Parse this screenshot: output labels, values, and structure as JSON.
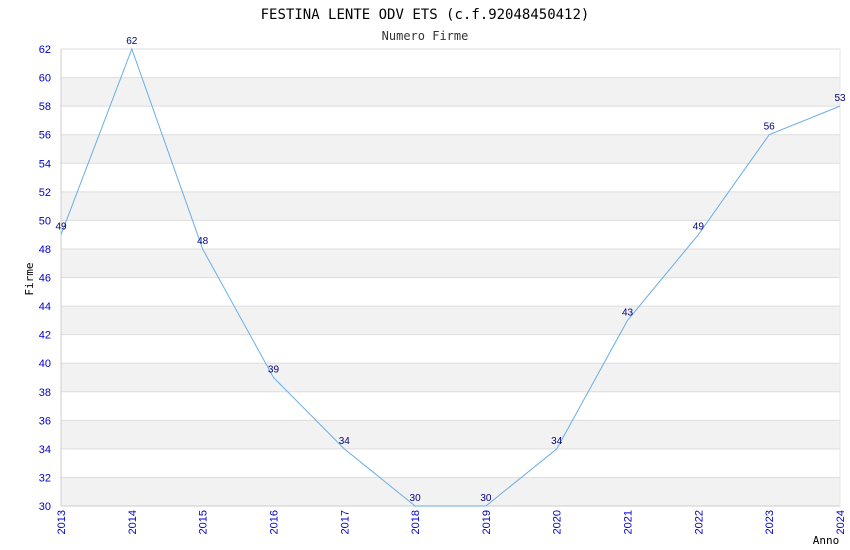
{
  "chart_data": {
    "type": "line",
    "title": "FESTINA LENTE ODV ETS (c.f.92048450412)",
    "subtitle": "Numero Firme",
    "xlabel": "Anno",
    "ylabel": "Firme",
    "categories": [
      "2013",
      "2014",
      "2015",
      "2016",
      "2017",
      "2018",
      "2019",
      "2020",
      "2021",
      "2022",
      "2023",
      "2024"
    ],
    "values": [
      49,
      62,
      48,
      39,
      34,
      30,
      30,
      34,
      43,
      49,
      56,
      58
    ],
    "data_labels": [
      "49",
      "62",
      "48",
      "39",
      "34",
      "30",
      "30",
      "34",
      "43",
      "49",
      "56",
      "53"
    ],
    "ylim": [
      30,
      62
    ],
    "yticks": [
      "30",
      "32",
      "34",
      "36",
      "38",
      "40",
      "42",
      "44",
      "46",
      "48",
      "50",
      "52",
      "54",
      "56",
      "58",
      "60",
      "62"
    ],
    "grid": true,
    "colors": {
      "line": "#6aaee8",
      "band_light": "#f2f2f2",
      "band_white": "#ffffff",
      "gridline": "#dddddd",
      "tick_text": "#0000cc",
      "label_text": "#000080"
    }
  }
}
